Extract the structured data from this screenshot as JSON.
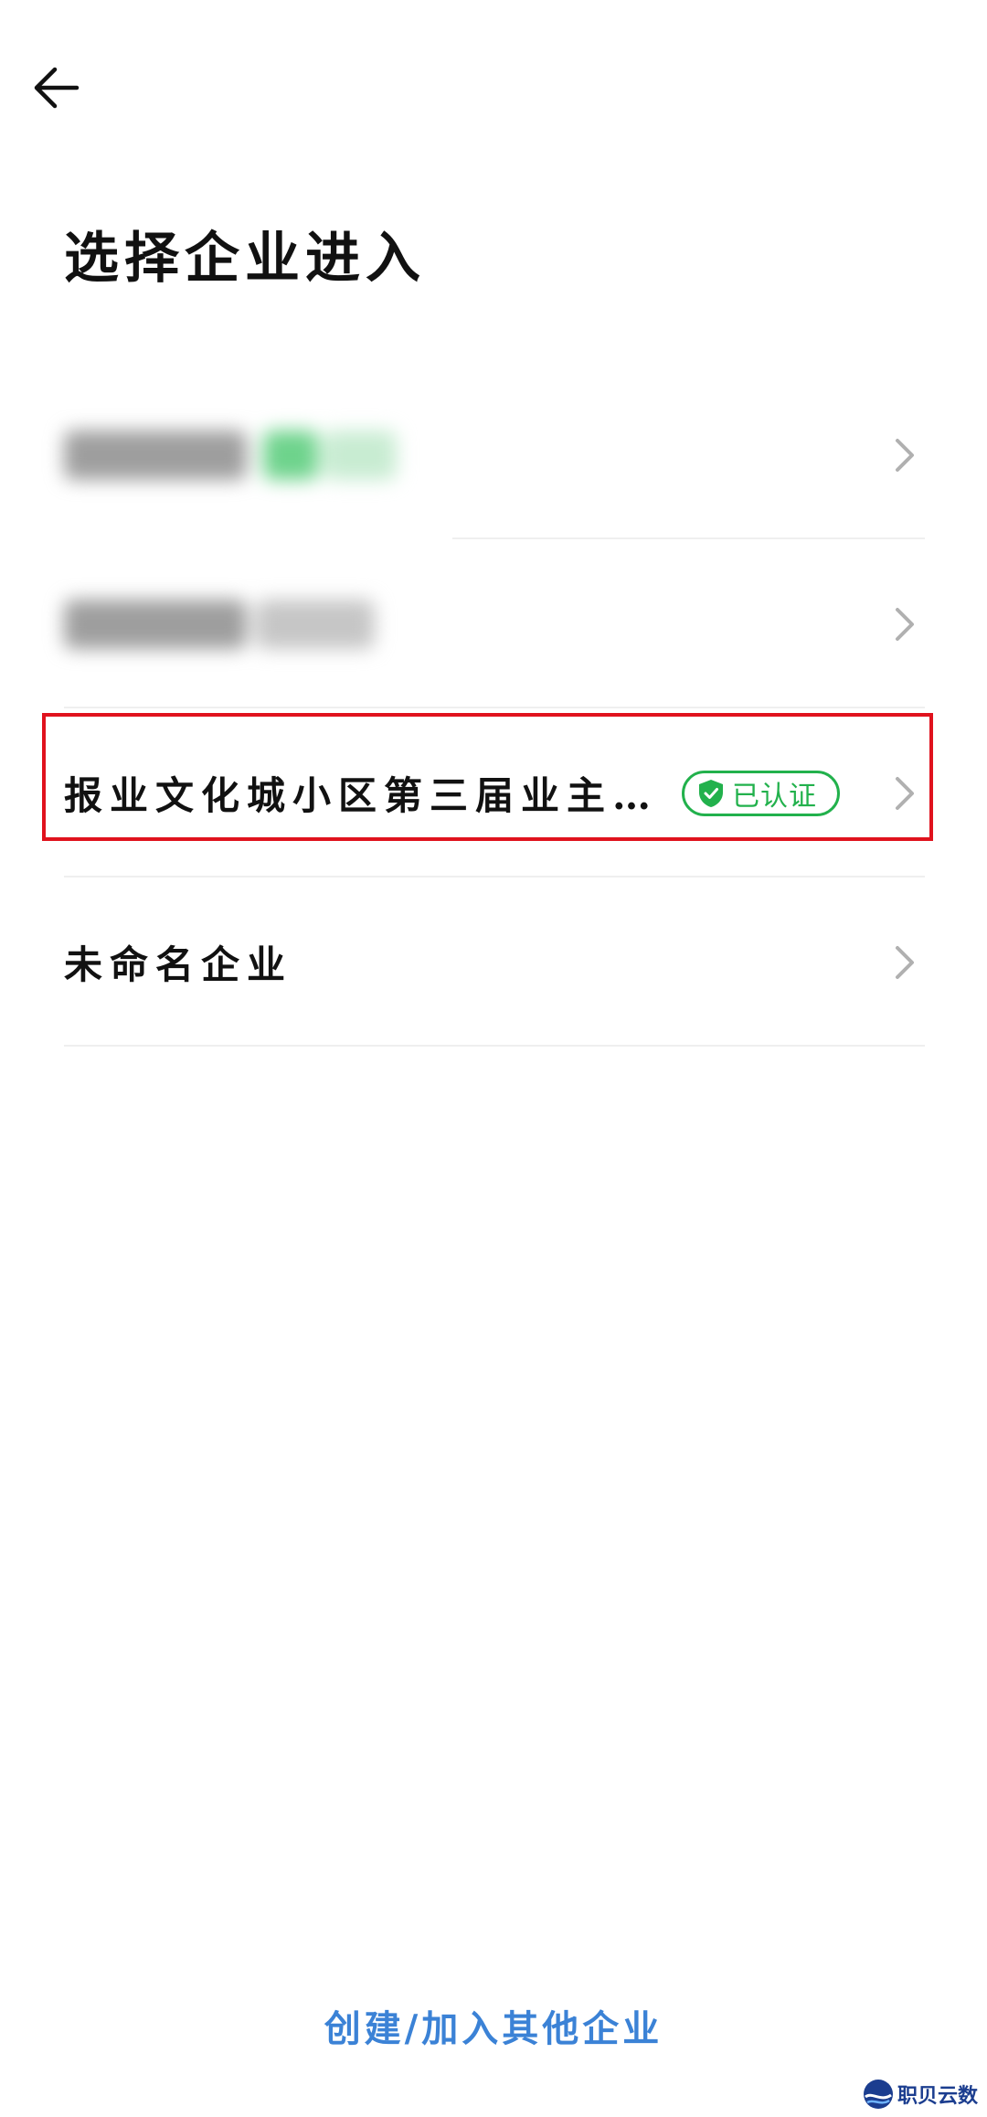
{
  "nav": {
    "back_icon": "arrow-left-icon"
  },
  "page": {
    "title": "选择企业进入"
  },
  "organizations": [
    {
      "name": "",
      "blurred": true,
      "verified": false
    },
    {
      "name": "",
      "blurred": true,
      "verified": false
    },
    {
      "name": "报业文化城小区第三届业主…",
      "blurred": false,
      "verified": true,
      "badge_label": "已认证",
      "highlighted": true
    },
    {
      "name": "未命名企业",
      "blurred": false,
      "verified": false
    }
  ],
  "footer": {
    "create_join_label": "创建/加入其他企业"
  },
  "watermark": {
    "text": "职贝云数"
  },
  "colors": {
    "accent_blue": "#3b82d6",
    "verified_green": "#22b14c",
    "highlight_red": "#e0121d"
  }
}
